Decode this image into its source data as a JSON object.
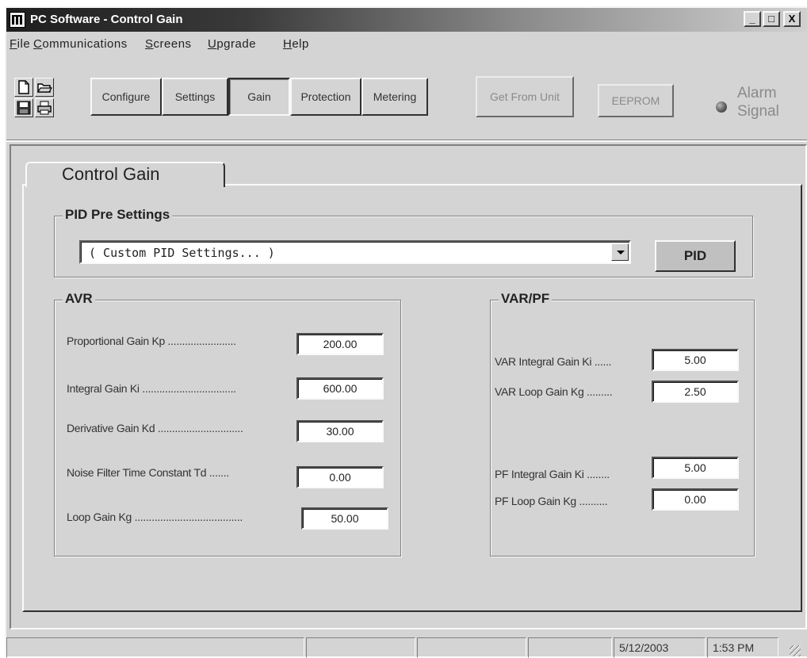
{
  "window": {
    "title": "PC Software - Control Gain",
    "controls": {
      "minimize": "_",
      "maximize": "□",
      "close": "X"
    }
  },
  "menu": {
    "items": [
      {
        "first": "F",
        "rest": "ile"
      },
      {
        "first": "C",
        "rest": "ommunications"
      },
      {
        "first": "S",
        "rest": "creens"
      },
      {
        "first": "U",
        "rest": "pgrade"
      },
      {
        "first": "H",
        "rest": "elp"
      }
    ]
  },
  "toolbar": {
    "icons": [
      "new-file-icon",
      "open-folder-icon",
      "save-disk-icon",
      "print-icon"
    ],
    "buttons": [
      "Configure",
      "Settings",
      "Gain",
      "Protection",
      "Metering"
    ],
    "active_button": "Gain",
    "get_from_unit": "Get From Unit",
    "eeprom": "EEPROM",
    "alarm_line1": "Alarm",
    "alarm_line2": "Signal"
  },
  "tab": {
    "label": "Control Gain"
  },
  "pid_presets": {
    "group_title": "PID Pre Settings",
    "selected": "( Custom PID Settings... )",
    "button": "PID"
  },
  "avr": {
    "group_title": "AVR",
    "fields": [
      {
        "label": "Proportional Gain Kp ........................",
        "value": "200.00"
      },
      {
        "label": "Integral Gain Ki .................................",
        "value": "600.00"
      },
      {
        "label": "Derivative Gain Kd ..............................",
        "value": "30.00"
      },
      {
        "label": "Noise Filter Time Constant Td .......",
        "value": "0.00"
      },
      {
        "label": "Loop Gain Kg ......................................",
        "value": "50.00"
      }
    ]
  },
  "varpf": {
    "group_title": "VAR/PF",
    "fields": [
      {
        "label": "VAR Integral Gain Ki ......",
        "value": "5.00"
      },
      {
        "label": "VAR Loop Gain Kg .........",
        "value": "2.50"
      },
      {
        "label": "PF Integral Gain Ki ........",
        "value": "5.00"
      },
      {
        "label": "PF Loop Gain Kg ..........",
        "value": "0.00"
      }
    ]
  },
  "status": {
    "date": "5/12/2003",
    "time": "1:53 PM"
  },
  "colors": {
    "face": "#d4d4d4",
    "title_dark": "#1e1e1e"
  }
}
